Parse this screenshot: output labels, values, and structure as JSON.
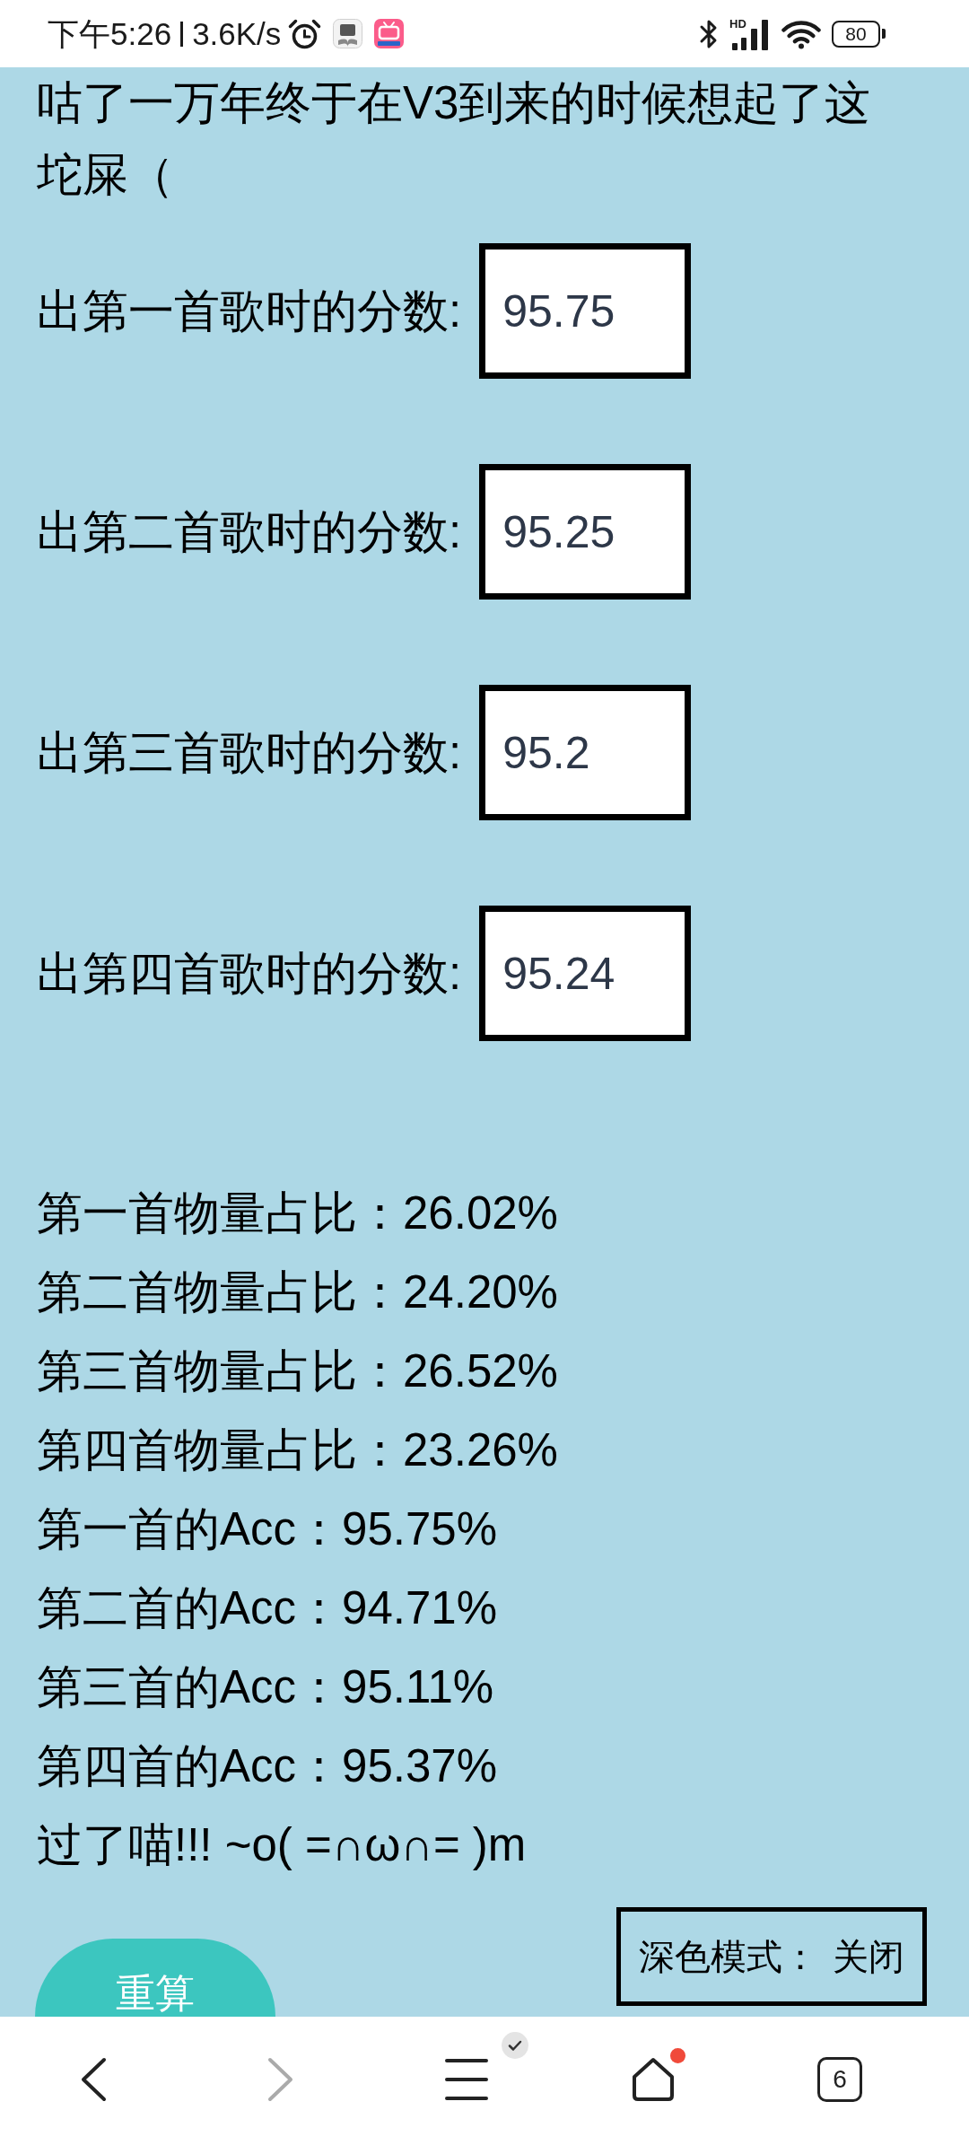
{
  "status_bar": {
    "time": "下午5:26",
    "net_speed": "3.6K/s",
    "signal_label": "HD",
    "battery": "80"
  },
  "intro": "咕了一万年终于在V3到来的时候想起了这坨屎（",
  "score_inputs": [
    {
      "label": "出第一首歌时的分数:",
      "value": "95.75"
    },
    {
      "label": "出第二首歌时的分数:",
      "value": "95.25"
    },
    {
      "label": "出第三首歌时的分数:",
      "value": "95.2"
    },
    {
      "label": "出第四首歌时的分数:",
      "value": "95.24"
    }
  ],
  "results": [
    "第一首物量占比：26.02%",
    "第二首物量占比：24.20%",
    "第三首物量占比：26.52%",
    "第四首物量占比：23.26%",
    "第一首的Acc：95.75%",
    "第二首的Acc：94.71%",
    "第三首的Acc：95.11%",
    "第四首的Acc：95.37%"
  ],
  "verdict": "过了喵!!! ~o( =∩ω∩= )m",
  "recalculate_button": {
    "label": "重算"
  },
  "dark_mode_toggle": {
    "label": "深色模式：",
    "value": "关闭"
  },
  "nav_bar": {
    "back": {
      "disabled": false
    },
    "forward": {
      "disabled": true
    },
    "menu": {
      "badge": true
    },
    "home": {
      "notification": true
    },
    "tabs": {
      "count": "6"
    }
  }
}
